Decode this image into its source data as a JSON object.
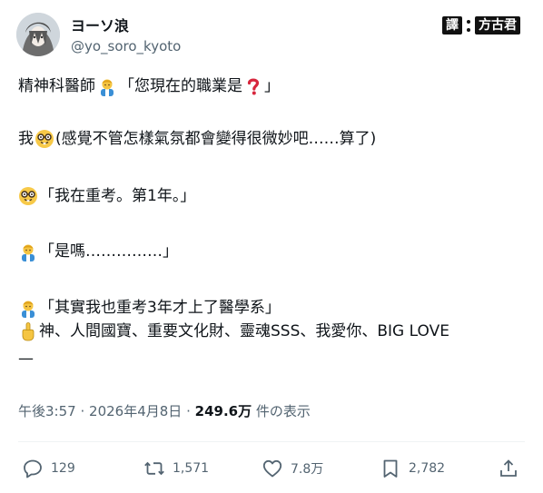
{
  "author": {
    "display_name": "ヨーソ浪",
    "handle": "@yo_soro_kyoto"
  },
  "translator_badge": {
    "left": "譯",
    "right": "方古君"
  },
  "tweet": {
    "lines": [
      "精神科醫師",
      "「您現在的職業是",
      "」",
      "我",
      "(感覺不管怎樣氣氛都會變得很微妙吧……算了)",
      "「我在重考。第1年。」",
      "「是嗎……………」",
      "「其實我也重考3年才上了醫學系」",
      "神、人間國寶、重要文化財、靈魂SSS、我愛你、BIG LOVE",
      "—"
    ]
  },
  "meta": {
    "time": "午後3:57",
    "sep1": "·",
    "date": "2026年4月8日",
    "sep2": "·",
    "views": "249.6万",
    "views_suffix": "件の表示"
  },
  "actions": {
    "replies": "129",
    "reposts": "1,571",
    "likes": "7.8万",
    "bookmarks": "2,782"
  },
  "icons": [
    "reply-icon",
    "repost-icon",
    "like-icon",
    "bookmark-icon",
    "share-icon",
    "doctor-emoji",
    "question-emoji",
    "nerd-emoji",
    "point-up-emoji"
  ],
  "colors": {
    "text": "#0f1419",
    "secondary": "#536471",
    "divider": "#eff3f4"
  }
}
